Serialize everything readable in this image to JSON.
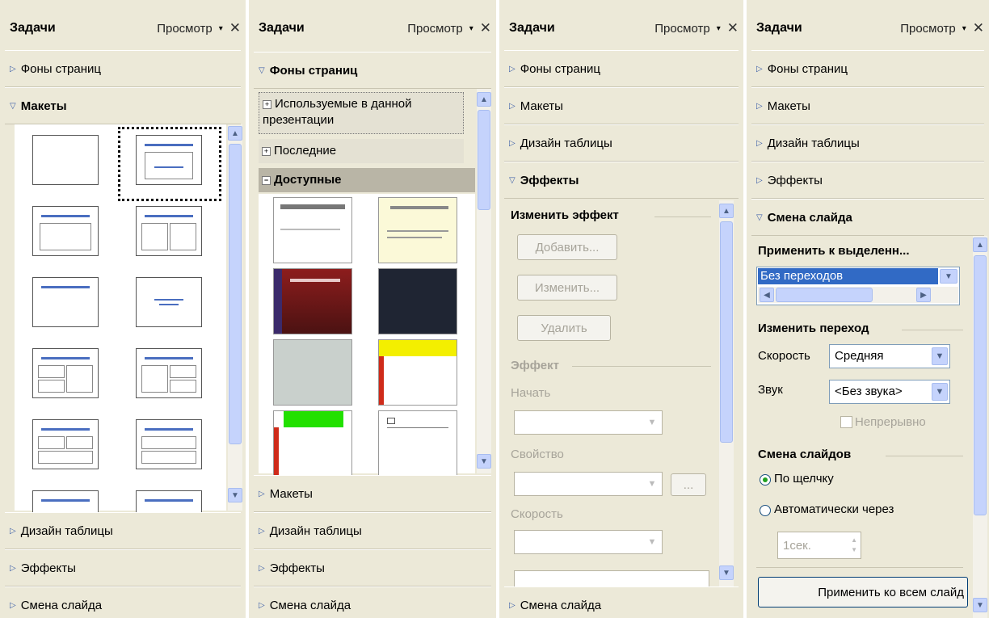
{
  "header": {
    "title": "Задачи",
    "view_label": "Просмотр",
    "dropdown_glyph": "▾",
    "close_glyph": "✕"
  },
  "icons": {
    "expand_triangle": "▷",
    "collapse_triangle": "▽",
    "scroll_up": "▲",
    "scroll_down": "▼",
    "plus": "+",
    "minus": "−"
  },
  "sections": {
    "backgrounds": "Фоны страниц",
    "layouts": "Макеты",
    "table_design": "Дизайн таблицы",
    "effects": "Эффекты",
    "slide_transition": "Смена слайда"
  },
  "panel2": {
    "tree": {
      "used": "Используемые в данной презентации",
      "recent": "Последние",
      "available": "Доступные"
    }
  },
  "panel3": {
    "change_effect": "Изменить эффект",
    "add_button": "Добавить...",
    "change_button": "Изменить...",
    "delete_button": "Удалить",
    "effect_group": "Эффект",
    "start_label": "Начать",
    "property_label": "Свойство",
    "speed_label": "Скорость",
    "more_button": "..."
  },
  "panel4": {
    "apply_to_selected": "Применить к выделенн...",
    "selected_transition": "Без переходов",
    "change_transition": "Изменить переход",
    "speed_label": "Скорость",
    "speed_value": "Средняя",
    "sound_label": "Звук",
    "sound_value": "<Без звука>",
    "loop_label": "Непрерывно",
    "advance_group": "Смена слайдов",
    "on_click": "По щелчку",
    "automatic": "Автоматически через",
    "delay_value": "1сек.",
    "apply_all_button": "Применить ко всем слайд"
  },
  "colors": {
    "panel_bg": "#ece9d8",
    "accent_blue": "#4a6ec0",
    "selection": "#316ac5",
    "scroll": "#c5d3fc"
  }
}
